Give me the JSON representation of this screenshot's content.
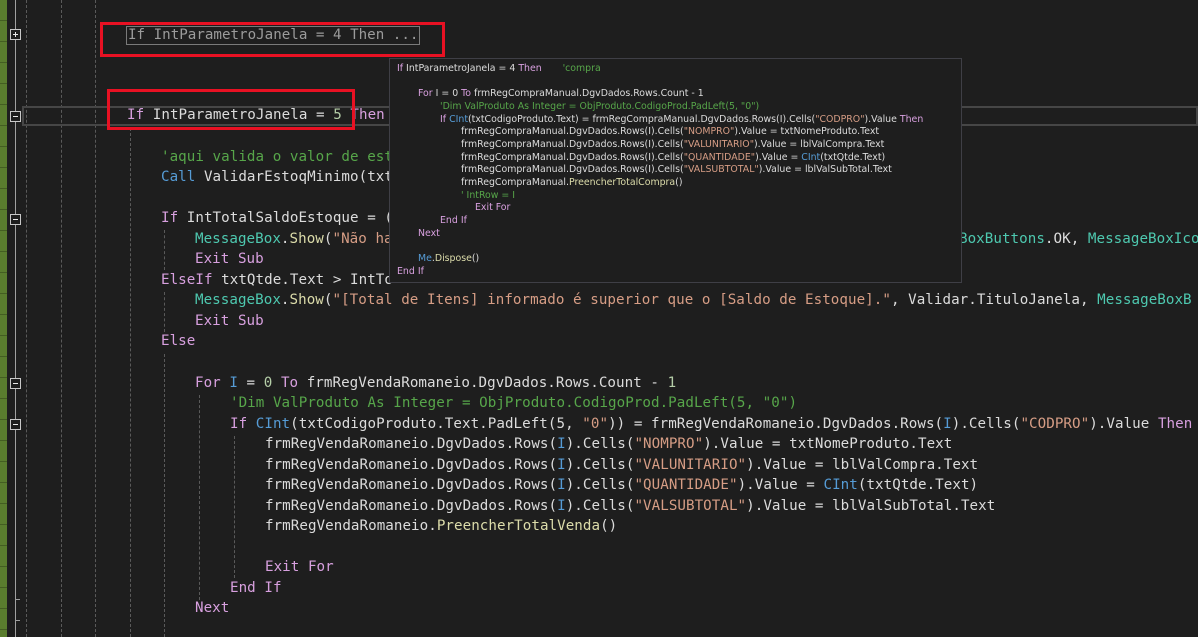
{
  "editor": {
    "collapsed_region": {
      "text": "If IntParametroJanela = 4 Then ..."
    },
    "lines": [
      {
        "id": "if5",
        "tokens": [
          [
            "kw",
            "If"
          ],
          [
            "plain",
            " IntParametroJanela = "
          ],
          [
            "num",
            "5"
          ],
          [
            "plain",
            " "
          ],
          [
            "kw",
            "Then"
          ]
        ]
      },
      {
        "id": "comment1",
        "tokens": [
          [
            "cm",
            "'aqui valida o valor de est"
          ]
        ]
      },
      {
        "id": "call",
        "tokens": [
          [
            "kw2",
            "Call"
          ],
          [
            "plain",
            " ValidarEstoqMinimo(txt"
          ]
        ]
      },
      {
        "id": "if-saldo",
        "tokens": [
          [
            "kw",
            "If"
          ],
          [
            "plain",
            " IntTotalSaldoEstoque = ("
          ]
        ]
      },
      {
        "id": "msg1",
        "tokens": [
          [
            "tp",
            "MessageBox"
          ],
          [
            "plain",
            "."
          ],
          [
            "fn",
            "Show"
          ],
          [
            "plain",
            "("
          ],
          [
            "str",
            "\"Não ha"
          ]
        ]
      },
      {
        "id": "msg1-tail",
        "tokens": [
          [
            "tp",
            "BoxButtons"
          ],
          [
            "plain",
            ".OK, "
          ],
          [
            "tp",
            "MessageBoxIco"
          ]
        ]
      },
      {
        "id": "exit1",
        "tokens": [
          [
            "kw",
            "Exit"
          ],
          [
            "plain",
            " "
          ],
          [
            "kw",
            "Sub"
          ]
        ]
      },
      {
        "id": "elseif",
        "tokens": [
          [
            "kw",
            "ElseIf"
          ],
          [
            "plain",
            " txtQtde.Text > IntTo"
          ]
        ]
      },
      {
        "id": "msg2",
        "tokens": [
          [
            "tp",
            "MessageBox"
          ],
          [
            "plain",
            "."
          ],
          [
            "fn",
            "Show"
          ],
          [
            "plain",
            "("
          ],
          [
            "str",
            "\"[Total de Itens] informado é superior que o [Saldo de Estoque].\""
          ],
          [
            "plain",
            ", Validar.TituloJanela, "
          ],
          [
            "tp",
            "MessageBoxB"
          ]
        ]
      },
      {
        "id": "exit2",
        "tokens": [
          [
            "kw",
            "Exit"
          ],
          [
            "plain",
            " "
          ],
          [
            "kw",
            "Sub"
          ]
        ]
      },
      {
        "id": "else",
        "tokens": [
          [
            "kw",
            "Else"
          ]
        ]
      },
      {
        "id": "for",
        "tokens": [
          [
            "kw",
            "For"
          ],
          [
            "plain",
            " "
          ],
          [
            "kw2",
            "I"
          ],
          [
            "plain",
            " = "
          ],
          [
            "num",
            "0"
          ],
          [
            "plain",
            " "
          ],
          [
            "kw",
            "To"
          ],
          [
            "plain",
            " frmRegVendaRomaneio.DgvDados.Rows.Count - "
          ],
          [
            "num",
            "1"
          ]
        ]
      },
      {
        "id": "dim-comment",
        "tokens": [
          [
            "cm",
            "'Dim ValProduto As Integer = ObjProduto.CodigoProd.PadLeft(5, \"0\")"
          ]
        ]
      },
      {
        "id": "if-cint",
        "tokens": [
          [
            "kw",
            "If"
          ],
          [
            "plain",
            " "
          ],
          [
            "kw2",
            "CInt"
          ],
          [
            "plain",
            "(txtCodigoProduto.Text.PadLeft(5, "
          ],
          [
            "str",
            "\"0\""
          ],
          [
            "plain",
            ")) = frmRegVendaRomaneio.DgvDados.Rows("
          ],
          [
            "kw2",
            "I"
          ],
          [
            "plain",
            ").Cells("
          ],
          [
            "str",
            "\"CODPRO\""
          ],
          [
            "plain",
            ").Value "
          ],
          [
            "kw",
            "Then"
          ]
        ]
      },
      {
        "id": "nompro",
        "tokens": [
          [
            "plain",
            "frmRegVendaRomaneio.DgvDados.Rows("
          ],
          [
            "kw2",
            "I"
          ],
          [
            "plain",
            ").Cells("
          ],
          [
            "str",
            "\"NOMPRO\""
          ],
          [
            "plain",
            ").Value = txtNomeProduto.Text"
          ]
        ]
      },
      {
        "id": "valunit",
        "tokens": [
          [
            "plain",
            "frmRegVendaRomaneio.DgvDados.Rows("
          ],
          [
            "kw2",
            "I"
          ],
          [
            "plain",
            ").Cells("
          ],
          [
            "str",
            "\"VALUNITARIO\""
          ],
          [
            "plain",
            ").Value = lblValCompra.Text"
          ]
        ]
      },
      {
        "id": "qtde",
        "tokens": [
          [
            "plain",
            "frmRegVendaRomaneio.DgvDados.Rows("
          ],
          [
            "kw2",
            "I"
          ],
          [
            "plain",
            ").Cells("
          ],
          [
            "str",
            "\"QUANTIDADE\""
          ],
          [
            "plain",
            ").Value = "
          ],
          [
            "kw2",
            "CInt"
          ],
          [
            "plain",
            "(txtQtde.Text)"
          ]
        ]
      },
      {
        "id": "valsub",
        "tokens": [
          [
            "plain",
            "frmRegVendaRomaneio.DgvDados.Rows("
          ],
          [
            "kw2",
            "I"
          ],
          [
            "plain",
            ").Cells("
          ],
          [
            "str",
            "\"VALSUBTOTAL\""
          ],
          [
            "plain",
            ").Value = lblValSubTotal.Text"
          ]
        ]
      },
      {
        "id": "preencher",
        "tokens": [
          [
            "plain",
            "frmRegVendaRomaneio."
          ],
          [
            "fn",
            "PreencherTotalVenda"
          ],
          [
            "plain",
            "()"
          ]
        ]
      },
      {
        "id": "exitfor",
        "tokens": [
          [
            "kw",
            "Exit"
          ],
          [
            "plain",
            " "
          ],
          [
            "kw",
            "For"
          ]
        ]
      },
      {
        "id": "endif",
        "tokens": [
          [
            "kw",
            "End"
          ],
          [
            "plain",
            " "
          ],
          [
            "kw",
            "If"
          ]
        ]
      },
      {
        "id": "next",
        "tokens": [
          [
            "kw",
            "Next"
          ]
        ]
      }
    ]
  },
  "tooltip": {
    "lines": [
      {
        "tokens": [
          [
            "kw",
            "If"
          ],
          [
            "plain",
            " IntParametroJanela = 4 "
          ],
          [
            "kw",
            "Then"
          ],
          [
            "plain",
            "       "
          ],
          [
            "cm",
            "'compra"
          ]
        ]
      },
      {
        "tokens": []
      },
      {
        "tokens": [
          [
            "kw",
            "For"
          ],
          [
            "plain",
            " I = 0 "
          ],
          [
            "kw",
            "To"
          ],
          [
            "plain",
            " frmRegCompraManual.DgvDados.Rows.Count - 1"
          ]
        ]
      },
      {
        "tokens": [
          [
            "cm",
            "'Dim ValProduto As Integer = ObjProduto.CodigoProd.PadLeft(5, \"0\")"
          ]
        ]
      },
      {
        "tokens": [
          [
            "kw",
            "If"
          ],
          [
            "plain",
            " "
          ],
          [
            "kw2",
            "CInt"
          ],
          [
            "plain",
            "(txtCodigoProduto.Text) = frmRegCompraManual.DgvDados.Rows(I).Cells("
          ],
          [
            "str",
            "\"CODPRO\""
          ],
          [
            "plain",
            ").Value "
          ],
          [
            "kw",
            "Then"
          ]
        ]
      },
      {
        "tokens": [
          [
            "plain",
            "frmRegCompraManual.DgvDados.Rows(I).Cells("
          ],
          [
            "str",
            "\"NOMPRO\""
          ],
          [
            "plain",
            ").Value = txtNomeProduto.Text"
          ]
        ]
      },
      {
        "tokens": [
          [
            "plain",
            "frmRegCompraManual.DgvDados.Rows(I).Cells("
          ],
          [
            "str",
            "\"VALUNITARIO\""
          ],
          [
            "plain",
            ").Value = lblValCompra.Text"
          ]
        ]
      },
      {
        "tokens": [
          [
            "plain",
            "frmRegCompraManual.DgvDados.Rows(I).Cells("
          ],
          [
            "str",
            "\"QUANTIDADE\""
          ],
          [
            "plain",
            ").Value = "
          ],
          [
            "kw2",
            "CInt"
          ],
          [
            "plain",
            "(txtQtde.Text)"
          ]
        ]
      },
      {
        "tokens": [
          [
            "plain",
            "frmRegCompraManual.DgvDados.Rows(I).Cells("
          ],
          [
            "str",
            "\"VALSUBTOTAL\""
          ],
          [
            "plain",
            ").Value = lblValSubTotal.Text"
          ]
        ]
      },
      {
        "tokens": [
          [
            "plain",
            "frmRegCompraManual."
          ],
          [
            "fn",
            "PreencherTotalCompra"
          ],
          [
            "plain",
            "()"
          ]
        ]
      },
      {
        "tokens": [
          [
            "cm",
            "' IntRow = I"
          ]
        ]
      },
      {
        "tokens": [
          [
            "kw",
            "Exit"
          ],
          [
            "plain",
            " "
          ],
          [
            "kw",
            "For"
          ]
        ]
      },
      {
        "tokens": [
          [
            "kw",
            "End"
          ],
          [
            "plain",
            " "
          ],
          [
            "kw",
            "If"
          ]
        ]
      },
      {
        "tokens": [
          [
            "kw",
            "Next"
          ]
        ]
      },
      {
        "tokens": []
      },
      {
        "tokens": [
          [
            "kw2",
            "Me"
          ],
          [
            "plain",
            "."
          ],
          [
            "fn",
            "Dispose"
          ],
          [
            "plain",
            "()"
          ]
        ]
      },
      {
        "tokens": [
          [
            "kw",
            "End"
          ],
          [
            "plain",
            " "
          ],
          [
            "kw",
            "If"
          ]
        ]
      }
    ]
  },
  "colors": {
    "background": "#1e1e1e",
    "keyword": "#d8a0df",
    "keyword_blue": "#569cd6",
    "type": "#4ec9b0",
    "method": "#dcdcaa",
    "string": "#d69d85",
    "comment": "#57a64a",
    "highlight_box": "#e81123",
    "change_margin": "#5a7d2e"
  }
}
